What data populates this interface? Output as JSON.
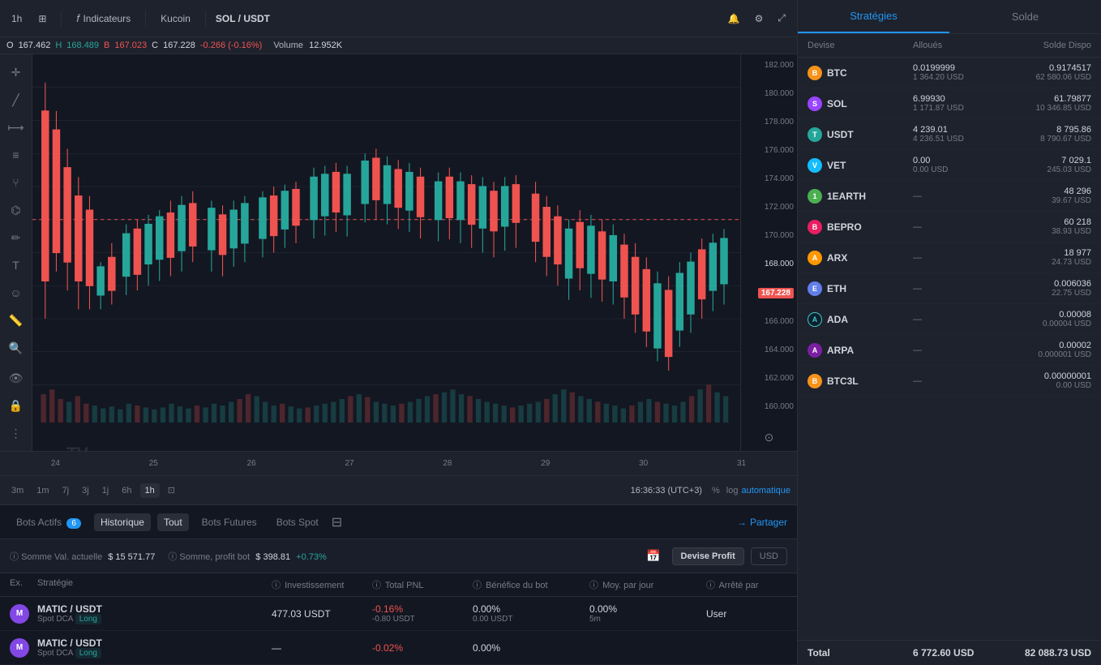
{
  "toolbar": {
    "timeframe": "1h",
    "multi_chart_icon": "⊞",
    "indicators_label": "Indicateurs",
    "exchange": "Kucoin",
    "pair": "SOL / USDT",
    "alert_icon": "🔔",
    "settings_icon": "⚙",
    "fullscreen_icon": "⤢"
  },
  "ohlc": {
    "o_label": "O",
    "o_val": "167.462",
    "h_label": "H",
    "h_val": "168.489",
    "b_label": "B",
    "b_val": "167.023",
    "c_label": "C",
    "c_val": "167.228",
    "change": "-0.266 (-0.16%)",
    "volume_label": "Volume",
    "volume_val": "12.952K"
  },
  "price_levels": [
    "182.000",
    "180.000",
    "178.000",
    "176.000",
    "174.000",
    "172.000",
    "170.000",
    "168.000",
    "166.000",
    "164.000",
    "162.000",
    "160.000"
  ],
  "current_price": "167.228",
  "time_labels": [
    "24",
    "25",
    "26",
    "27",
    "28",
    "29",
    "30",
    "31"
  ],
  "timeframes": [
    "3m",
    "1m",
    "7j",
    "3j",
    "1j",
    "6h",
    "1h"
  ],
  "active_tf": "1h",
  "time_display": "16:36:33 (UTC+3)",
  "percent_icon": "%",
  "log_label": "log",
  "auto_label": "automatique",
  "bots": {
    "actifs_label": "Bots Actifs",
    "actifs_count": "6",
    "historique_label": "Historique",
    "tout_label": "Tout",
    "futures_label": "Bots Futures",
    "spot_label": "Bots Spot",
    "partager_label": "Partager"
  },
  "stats": {
    "somme_val_label": "Somme Val. actuelle",
    "somme_val": "$ 15 571.77",
    "profit_label": "Somme, profit bot",
    "profit_val": "$ 398.81",
    "profit_pct": "+0.73%",
    "devise_profit": "Devise Profit",
    "usd": "USD"
  },
  "table_headers": {
    "ex": "Ex.",
    "strategie": "Stratégie",
    "investissement": "Investissement",
    "total_pnl": "Total PNL",
    "benefice_bot": "Bénéfice du bot",
    "moy_jour": "Moy. par jour",
    "arrete_par": "Arrêté par"
  },
  "table_rows": [
    {
      "icon_color": "#f0b90b",
      "icon_text": "M",
      "pair": "MATIC / USDT",
      "type": "Spot DCA",
      "direction": "Long",
      "investissement": "477.03 USDT",
      "pnl1": "-0.16%",
      "pnl2": "-0.80 USDT",
      "benefice1": "0.00%",
      "benefice2": "0.00 USDT",
      "moy1": "0.00%",
      "moy2": "5m",
      "arrete": "User"
    },
    {
      "icon_color": "#f0b90b",
      "icon_text": "M",
      "pair": "MATIC / USDT",
      "type": "Spot DCA",
      "direction": "Long",
      "investissement": "—",
      "pnl1": "-0.02%",
      "pnl2": "",
      "benefice1": "0.00%",
      "benefice2": "",
      "moy1": "",
      "moy2": "",
      "arrete": ""
    }
  ],
  "right_panel": {
    "strategies_tab": "Stratégies",
    "solde_tab": "Solde",
    "headers": {
      "devise": "Devise",
      "alloues": "Alloués",
      "solde_dispo": "Solde Dispo"
    },
    "coins": [
      {
        "name": "BTC",
        "dot_class": "dot-btc",
        "dot_text": "B",
        "alloc": "0.0199999",
        "alloc_usd": "1 364.20 USD",
        "dispo": "0.9174517",
        "dispo_usd": "62 580.06 USD"
      },
      {
        "name": "SOL",
        "dot_class": "dot-sol",
        "dot_text": "S",
        "alloc": "6.99930",
        "alloc_usd": "1 171.87 USD",
        "dispo": "61.79877",
        "dispo_usd": "10 346.85 USD"
      },
      {
        "name": "USDT",
        "dot_class": "dot-usdt",
        "dot_text": "T",
        "alloc": "4 239.01",
        "alloc_usd": "4 236.51 USD",
        "dispo": "8 795.86",
        "dispo_usd": "8 790.67 USD"
      },
      {
        "name": "VET",
        "dot_class": "dot-vet",
        "dot_text": "V",
        "alloc": "0.00",
        "alloc_usd": "0.00 USD",
        "dispo": "7 029.1",
        "dispo_usd": "245.03 USD"
      },
      {
        "name": "1EARTH",
        "dot_class": "dot-1earth",
        "dot_text": "1",
        "alloc": "—",
        "alloc_usd": "",
        "dispo": "48 296",
        "dispo_usd": "39.67 USD"
      },
      {
        "name": "BEPRO",
        "dot_class": "dot-bepro",
        "dot_text": "B",
        "alloc": "—",
        "alloc_usd": "",
        "dispo": "60 218",
        "dispo_usd": "38.93 USD"
      },
      {
        "name": "ARX",
        "dot_class": "dot-arx",
        "dot_text": "A",
        "alloc": "—",
        "alloc_usd": "",
        "dispo": "18 977",
        "dispo_usd": "24.73 USD"
      },
      {
        "name": "ETH",
        "dot_class": "dot-eth",
        "dot_text": "E",
        "alloc": "—",
        "alloc_usd": "",
        "dispo": "0.006036",
        "dispo_usd": "22.75 USD"
      },
      {
        "name": "ADA",
        "dot_class": "dot-ada",
        "dot_text": "A",
        "alloc": "—",
        "alloc_usd": "",
        "dispo": "0.00008",
        "dispo_usd": "0.00004 USD"
      },
      {
        "name": "ARPA",
        "dot_class": "dot-arpa",
        "dot_text": "A",
        "alloc": "—",
        "alloc_usd": "",
        "dispo": "0.00002",
        "dispo_usd": "0.000001 USD"
      },
      {
        "name": "BTC3L",
        "dot_class": "dot-btc3l",
        "dot_text": "B",
        "alloc": "—",
        "alloc_usd": "",
        "dispo": "0.00000001",
        "dispo_usd": "0.00 USD"
      }
    ],
    "total": {
      "label": "Total",
      "alloc": "6 772.60 USD",
      "dispo": "82 088.73 USD"
    }
  }
}
